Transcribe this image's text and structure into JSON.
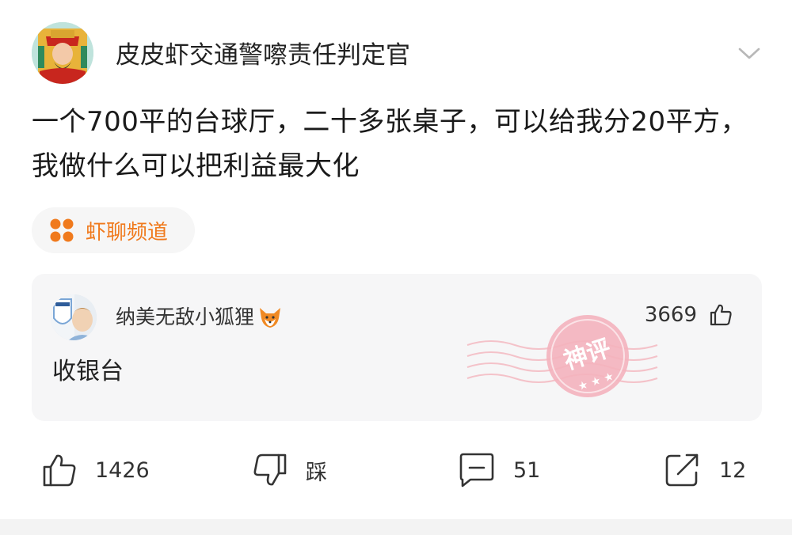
{
  "post": {
    "author": "皮皮虾交通警嚓责任判定官",
    "content": "一个700平的台球厅，二十多张桌子，可以给我分20平方，我做什么可以把利益最大化",
    "channel": "虾聊频道"
  },
  "god_comment": {
    "author": "纳美无敌小狐狸",
    "author_emoji": "fox-emoji",
    "likes": "3669",
    "text": "收银台",
    "badge_text": "神评"
  },
  "actions": {
    "like_count": "1426",
    "dislike_label": "踩",
    "comment_count": "51",
    "share_count": "12"
  },
  "icons": [
    "chevron-down-icon",
    "channel-dots-icon",
    "thumb-up-icon",
    "thumb-down-icon",
    "comment-icon",
    "share-icon"
  ],
  "colors": {
    "accent_orange": "#f07a1d",
    "card_bg": "#f6f6f7",
    "stamp_pink": "#f1a1ad"
  }
}
